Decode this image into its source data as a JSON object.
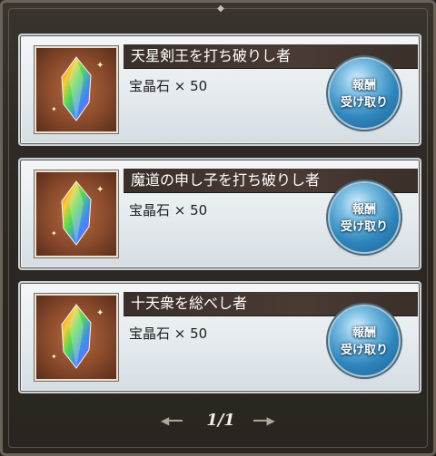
{
  "rewards": [
    {
      "title": "天星剣王を打ち破りし者",
      "reward": "宝晶石 × 50",
      "item_icon": "rainbow-crystal-icon",
      "claim_line1": "報酬",
      "claim_line2": "受け取り"
    },
    {
      "title": "魔道の申し子を打ち破りし者",
      "reward": "宝晶石 × 50",
      "item_icon": "rainbow-crystal-icon",
      "claim_line1": "報酬",
      "claim_line2": "受け取り"
    },
    {
      "title": "十天衆を総べし者",
      "reward": "宝晶石 × 50",
      "item_icon": "rainbow-crystal-icon",
      "claim_line1": "報酬",
      "claim_line2": "受け取り"
    }
  ],
  "pager": {
    "label": "1/1",
    "prev_icon": "left-ornament-arrow-icon",
    "next_icon": "right-ornament-arrow-icon"
  },
  "colors": {
    "panel_background": "#2a2520",
    "title_bar": "#3a2f29",
    "claim_button": "#2f86bd"
  }
}
